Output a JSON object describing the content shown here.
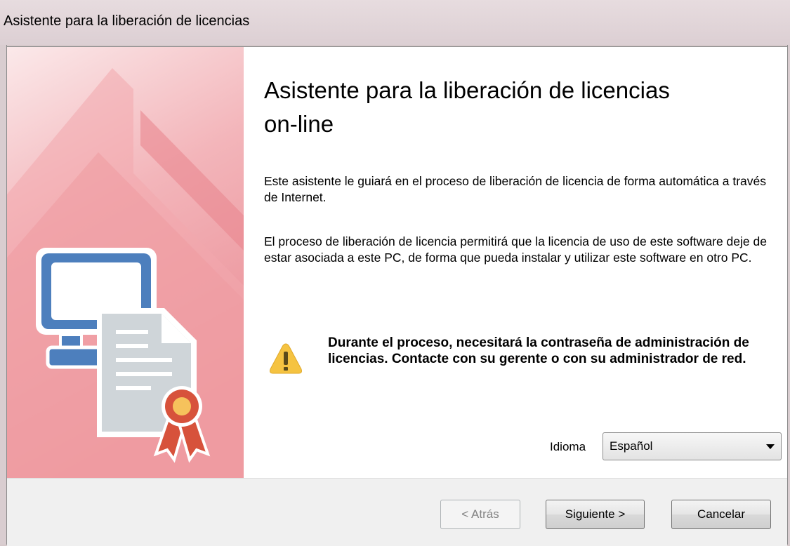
{
  "window": {
    "title": "Asistente para la liberación de licencias"
  },
  "content": {
    "heading": "Asistente para la liberación de licencias on-line",
    "paragraph1": "Este asistente le guiará en el proceso de liberación de licencia de forma automática a través de Internet.",
    "paragraph2": "El proceso de liberación de licencia permitirá que la licencia de uso de este software deje de estar asociada a este PC, de forma que pueda instalar y utilizar este software en otro PC.",
    "warning": "Durante el proceso, necesitará la contraseña de administración de licencias. Contacte con su gerente o con su administrador de red."
  },
  "language": {
    "label": "Idioma",
    "selected": "Español"
  },
  "buttons": {
    "back": "< Atrás",
    "back_enabled": false,
    "next": "Siguiente >",
    "cancel": "Cancelar"
  },
  "icons": {
    "side_illustration": "computer-license-icon",
    "warning": "warning-icon"
  },
  "colors": {
    "side_panel": "#f0a0a6",
    "accent_pink": "#e98b93",
    "warning_yellow": "#f5c341"
  }
}
